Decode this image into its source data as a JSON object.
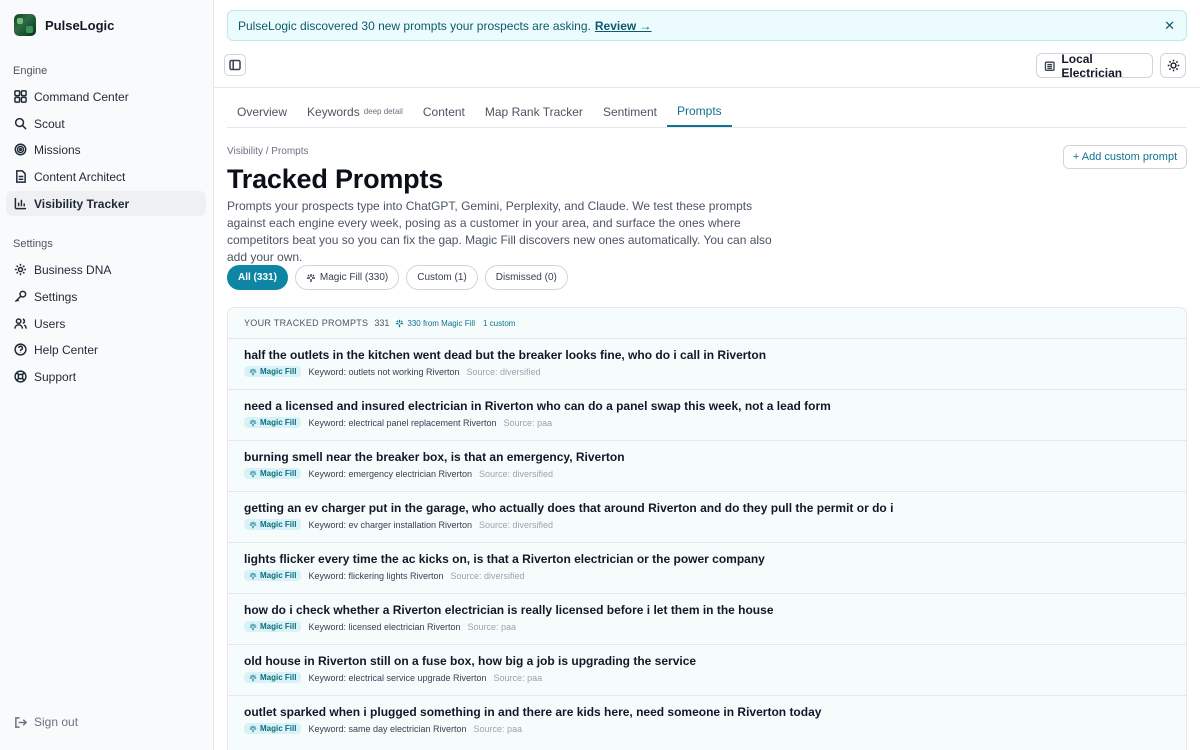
{
  "brand": {
    "name": "PulseLogic"
  },
  "sidebar": {
    "engine_label": "Engine",
    "engine_items": [
      {
        "label": "Command Center",
        "icon": "grid-icon"
      },
      {
        "label": "Scout",
        "icon": "search-icon"
      },
      {
        "label": "Missions",
        "icon": "target-icon"
      },
      {
        "label": "Content Architect",
        "icon": "document-icon"
      },
      {
        "label": "Visibility Tracker",
        "icon": "bar-chart-icon",
        "active": true
      }
    ],
    "settings_label": "Settings",
    "settings_items": [
      {
        "label": "Business DNA",
        "icon": "gear-icon"
      },
      {
        "label": "Settings",
        "icon": "key-icon"
      },
      {
        "label": "Users",
        "icon": "users-icon"
      },
      {
        "label": "Help Center",
        "icon": "help-icon"
      },
      {
        "label": "Support",
        "icon": "lifebuoy-icon"
      }
    ],
    "signout_label": "Sign out"
  },
  "banner": {
    "text": "PulseLogic discovered 30 new prompts your prospects are asking.",
    "link": "Review →",
    "close": "✕"
  },
  "topbar": {
    "business": "Local Electrician"
  },
  "tabs": [
    {
      "label": "Overview"
    },
    {
      "label": "Keywords",
      "sub": "deep detail"
    },
    {
      "label": "Content"
    },
    {
      "label": "Map Rank Tracker"
    },
    {
      "label": "Sentiment"
    },
    {
      "label": "Prompts",
      "active": true
    }
  ],
  "page": {
    "breadcrumb": "Visibility / Prompts",
    "title": "Tracked Prompts",
    "description": "Prompts your prospects type into ChatGPT, Gemini, Perplexity, and Claude. We test these prompts against each engine every week, posing as a customer in your area, and surface the ones where competitors beat you so you can fix the gap. Magic Fill discovers new ones automatically. You can also add your own.",
    "add_button": "+ Add custom prompt"
  },
  "filters": [
    {
      "label": "All (331)",
      "active": true
    },
    {
      "label": "Magic Fill (330)",
      "icon": "sparkle-icon"
    },
    {
      "label": "Custom (1)"
    },
    {
      "label": "Dismissed (0)"
    }
  ],
  "list": {
    "title": "YOUR TRACKED PROMPTS",
    "count": "331",
    "magic_count": "330 from Magic Fill",
    "custom_count": "1 custom",
    "badge_label": "Magic Fill",
    "rows": [
      {
        "text": "half the outlets in the kitchen went dead but the breaker looks fine, who do i call in Riverton",
        "keyword": "Keyword: outlets not working Riverton",
        "source": "Source: diversified"
      },
      {
        "text": "need a licensed and insured electrician in Riverton who can do a panel swap this week, not a lead form",
        "keyword": "Keyword: electrical panel replacement Riverton",
        "source": "Source: paa"
      },
      {
        "text": "burning smell near the breaker box, is that an emergency, Riverton",
        "keyword": "Keyword: emergency electrician Riverton",
        "source": "Source: diversified"
      },
      {
        "text": "getting an ev charger put in the garage, who actually does that around Riverton and do they pull the permit or do i",
        "keyword": "Keyword: ev charger installation Riverton",
        "source": "Source: diversified"
      },
      {
        "text": "lights flicker every time the ac kicks on, is that a Riverton electrician or the power company",
        "keyword": "Keyword: flickering lights Riverton",
        "source": "Source: diversified"
      },
      {
        "text": "how do i check whether a Riverton electrician is really licensed before i let them in the house",
        "keyword": "Keyword: licensed electrician Riverton",
        "source": "Source: paa"
      },
      {
        "text": "old house in Riverton still on a fuse box, how big a job is upgrading the service",
        "keyword": "Keyword: electrical service upgrade Riverton",
        "source": "Source: paa"
      },
      {
        "text": "outlet sparked when i plugged something in and there are kids here, need someone in Riverton today",
        "keyword": "Keyword: same day electrician Riverton",
        "source": "Source: paa"
      }
    ]
  }
}
